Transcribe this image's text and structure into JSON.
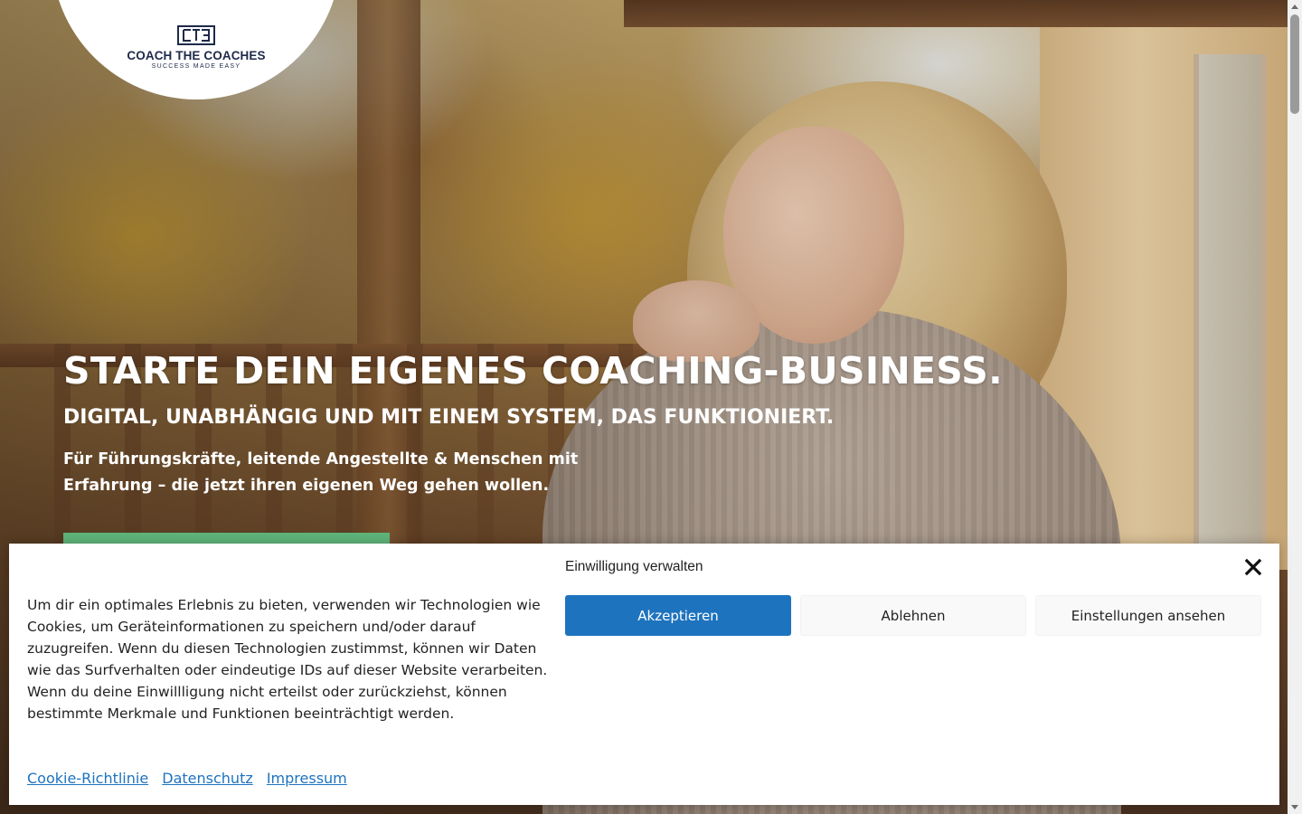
{
  "brand": {
    "name": "COACH THE COACHES",
    "tagline": "SUCCESS MADE EASY",
    "color": "#1e2a4a"
  },
  "hero": {
    "title": "STARTE DEIN EIGENES COACHING-BUSINESS.",
    "subtitle": "DIGITAL, UNABHÄNGIG UND MIT EINEM SYSTEM, DAS FUNKTIONIERT.",
    "description": "Für Führungskräfte, leitende Angestellte & Menschen mit Erfahrung – die jetzt ihren eigenen Weg gehen wollen.",
    "cta_color": "#5fb57a"
  },
  "cookie_banner": {
    "title": "Einwilligung verwalten",
    "text": "Um dir ein optimales Erlebnis zu bieten, verwenden wir Technologien wie Cookies, um Geräteinformationen zu speichern und/oder darauf zuzugreifen. Wenn du diesen Technologien zustimmst, können wir Daten wie das Surfverhalten oder eindeutige IDs auf dieser Website verarbeiten. Wenn du deine Einwillligung nicht erteilst oder zurückziehst, können bestimmte Merkmale und Funktionen beeinträchtigt werden.",
    "accept_label": "Akzeptieren",
    "deny_label": "Ablehnen",
    "preferences_label": "Einstellungen ansehen",
    "close_icon": "close-icon",
    "accent_color": "#1e73be",
    "links": [
      {
        "label": "Cookie-Richtlinie"
      },
      {
        "label": "Datenschutz"
      },
      {
        "label": "Impressum"
      }
    ]
  }
}
